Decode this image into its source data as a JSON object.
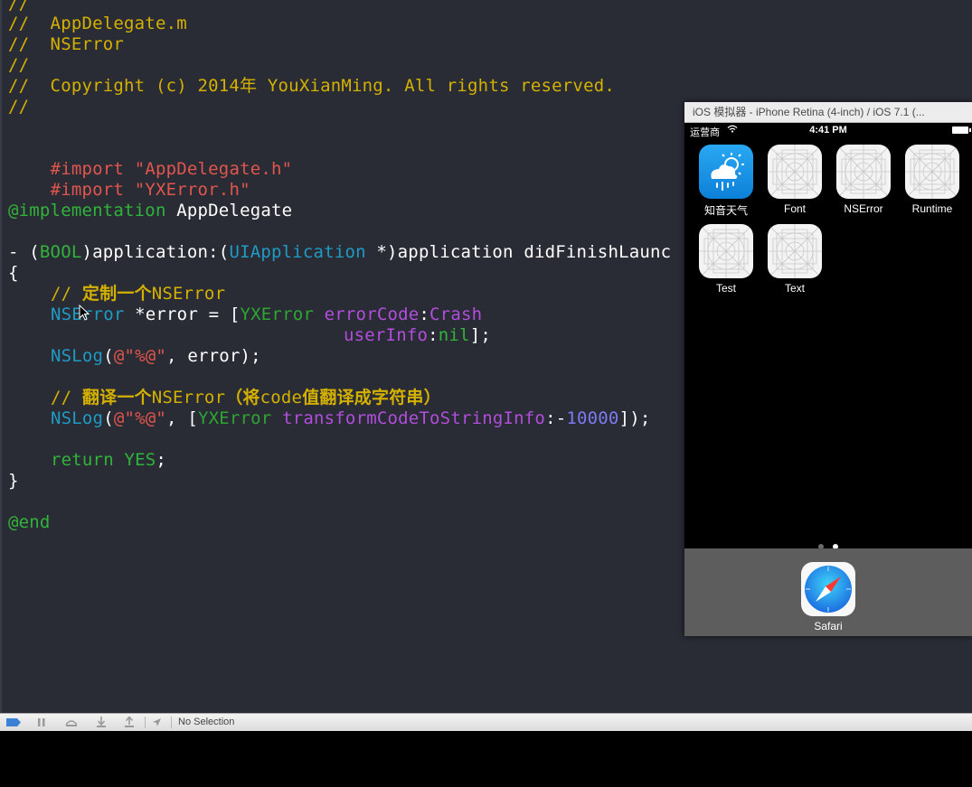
{
  "editor": {
    "lines": [
      {
        "t": "//"
      },
      {
        "t": "//  AppDelegate.m"
      },
      {
        "t": "//  NSError"
      },
      {
        "t": "//"
      },
      {
        "t": "//  Copyright (c) 2014年 YouXianMing. All rights reserved."
      },
      {
        "t": "//"
      },
      {
        "t": "#import",
        "s": "\"AppDelegate.h\""
      },
      {
        "t": "#import",
        "s": "\"YXError.h\""
      },
      {
        "kw": "@implementation",
        "p": " AppDelegate"
      },
      {
        "a": "- (",
        "b": "BOOL",
        "c": ")application:(",
        "d": "UIApplication",
        "e": " *)application didFinishLaunc"
      },
      {
        "t": "{"
      },
      {
        "c1": "// ",
        "c2": "定制一个",
        "c3": "NSError"
      },
      {
        "a": "NSError",
        "b": " *error = [",
        "c": "YXError",
        "d": " ",
        "e": "errorCode",
        "f": ":",
        "g": "Crash"
      },
      {
        "a": "userInfo",
        "b": ":",
        "c": "nil",
        "d": "];"
      },
      {
        "a": "NSLog",
        "b": "(",
        "c": "@\"%@\"",
        "d": ", error);"
      },
      {
        "c1": "// ",
        "c2": "翻译一个",
        "c3": "NSError",
        "c4": "（将",
        "c5": "code",
        "c6": "值翻译成字符串）"
      },
      {
        "a": "NSLog",
        "b": "(",
        "c": "@\"%@\"",
        "d": ", [",
        "e": "YXError",
        "f": " ",
        "g": "transformCodeToStringInfo",
        "h": ":-",
        "i": "10000",
        "j": "]);"
      },
      {
        "a": "return",
        "b": " ",
        "c": "YES",
        "d": ";"
      },
      {
        "t": "}"
      },
      {
        "t": "@end"
      }
    ]
  },
  "debug_bar": {
    "selection_label": "No Selection"
  },
  "simulator": {
    "title": "iOS 模拟器 - iPhone Retina (4-inch) / iOS 7.1 (...",
    "carrier": "运营商",
    "time": "4:41 PM",
    "apps": [
      {
        "label": "知音天气",
        "icon": "weather-app-icon"
      },
      {
        "label": "Font",
        "icon": "placeholder-app-icon"
      },
      {
        "label": "NSError",
        "icon": "placeholder-app-icon"
      },
      {
        "label": "Runtime",
        "icon": "placeholder-app-icon"
      },
      {
        "label": "Test",
        "icon": "placeholder-app-icon"
      },
      {
        "label": "Text",
        "icon": "placeholder-app-icon"
      }
    ],
    "page_count": 2,
    "current_page": 2,
    "dock": [
      {
        "label": "Safari",
        "icon": "safari-icon"
      }
    ]
  },
  "colors": {
    "editor_bg": "#292b35",
    "comment": "#d4b100",
    "string": "#e0564d",
    "keyword": "#31b43a",
    "class": "#1f9bc4",
    "method": "#b14edc",
    "number": "#7d7bf0"
  }
}
